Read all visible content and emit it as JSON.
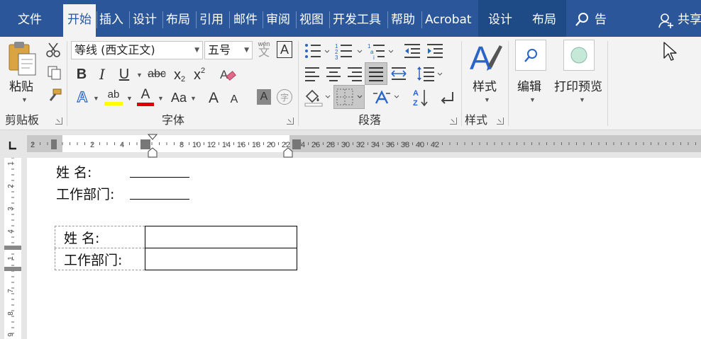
{
  "tabs": [
    {
      "label": "文件"
    },
    {
      "label": "开始"
    },
    {
      "label": "插入"
    },
    {
      "label": "设计"
    },
    {
      "label": "布局"
    },
    {
      "label": "引用"
    },
    {
      "label": "邮件"
    },
    {
      "label": "审阅"
    },
    {
      "label": "视图"
    },
    {
      "label": "开发工具"
    },
    {
      "label": "帮助"
    },
    {
      "label": "Acrobat"
    },
    {
      "label": "设计"
    },
    {
      "label": "布局"
    }
  ],
  "tellme": "告诉我",
  "share": "共享",
  "clipboard": {
    "paste": "粘贴",
    "group": "剪贴板"
  },
  "font": {
    "name": "等线 (西文正文)",
    "size": "五号",
    "wen_small": "wén",
    "wen": "文",
    "a_box": "A",
    "bold": "B",
    "italic": "I",
    "underline": "U",
    "strike": "abc",
    "sub": "x",
    "sub2": "2",
    "sup": "x",
    "sup2": "2",
    "effects": "A",
    "highlight": "ab",
    "color": "A",
    "case": "Aa",
    "grow": "A",
    "shrink": "A",
    "shade": "A",
    "circle": "字",
    "group": "字体"
  },
  "paragraph": {
    "group": "段落"
  },
  "styles": {
    "label": "样式",
    "group": "样式"
  },
  "editing": {
    "label": "编辑"
  },
  "print": {
    "label": "打印预览"
  },
  "ruler": {
    "h_left": [
      "2",
      "2",
      "4"
    ],
    "h_right": [
      "8",
      "10",
      "12",
      "14",
      "16",
      "18",
      "20",
      "22",
      "24",
      "26",
      "28",
      "30",
      "32",
      "34",
      "36",
      "38",
      "40",
      "42"
    ],
    "v": [
      "1",
      "2",
      "3",
      "4",
      "1",
      "7",
      "8",
      "9"
    ]
  },
  "doc": {
    "name_label": "姓      名:",
    "dept_label": "工作部门:",
    "table": [
      {
        "label": "姓      名:",
        "value": ""
      },
      {
        "label": "工作部门:",
        "value": ""
      }
    ]
  },
  "colors": {
    "brand": "#2b579a",
    "highlight": "#ffff00",
    "font_color": "#e00000"
  }
}
